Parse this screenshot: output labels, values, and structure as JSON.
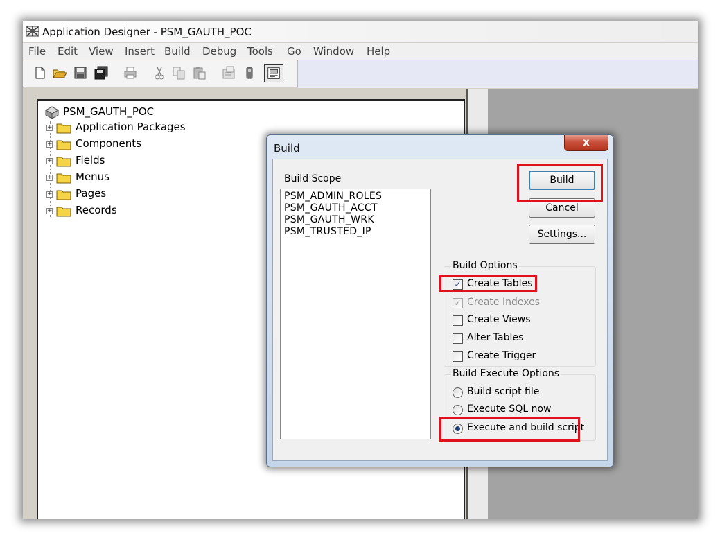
{
  "window": {
    "title": "Application Designer - PSM_GAUTH_POC",
    "icon": "app-designer-icon"
  },
  "menu": [
    "File",
    "Edit",
    "View",
    "Insert",
    "Build",
    "Debug",
    "Tools",
    "Go",
    "Window",
    "Help"
  ],
  "toolbar": [
    "new-icon",
    "open-icon",
    "save-icon",
    "save-all-icon",
    "print-icon",
    "cut-icon",
    "copy-icon",
    "paste-icon",
    "properties-icon",
    "upgrade-icon",
    "project-workspace-icon"
  ],
  "tree": {
    "root": "PSM_GAUTH_POC",
    "items": [
      "Application Packages",
      "Components",
      "Fields",
      "Menus",
      "Pages",
      "Records"
    ]
  },
  "dialog": {
    "title": "Build",
    "close_label": "x",
    "scope_label": "Build Scope",
    "scope_items": [
      "PSM_ADMIN_ROLES",
      "PSM_GAUTH_ACCT",
      "PSM_GAUTH_WRK",
      "PSM_TRUSTED_IP"
    ],
    "buttons": {
      "build": "Build",
      "cancel": "Cancel",
      "settings": "Settings..."
    },
    "build_options": {
      "label": "Build Options",
      "items": [
        {
          "label": "Create Tables",
          "checked": true,
          "disabled": false
        },
        {
          "label": "Create Indexes",
          "checked": true,
          "disabled": true
        },
        {
          "label": "Create Views",
          "checked": false,
          "disabled": false
        },
        {
          "label": "Alter Tables",
          "checked": false,
          "disabled": false
        },
        {
          "label": "Create Trigger",
          "checked": false,
          "disabled": false
        }
      ]
    },
    "execute_options": {
      "label": "Build Execute Options",
      "items": [
        {
          "label": "Build script file",
          "selected": false
        },
        {
          "label": "Execute SQL now",
          "selected": false
        },
        {
          "label": "Execute and build script",
          "selected": true
        }
      ]
    }
  },
  "highlight_color": "#e0111c"
}
